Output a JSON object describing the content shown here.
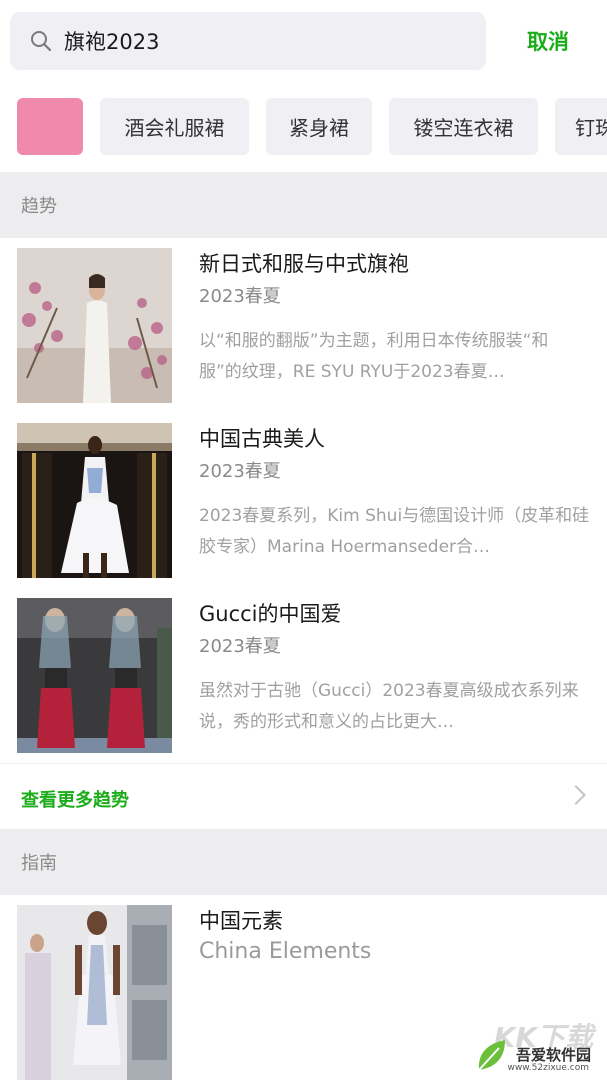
{
  "search": {
    "query": "旗袍2023",
    "cancel_label": "取消"
  },
  "colors": {
    "accent_green": "#1aad19",
    "chip_pink": "#f08aac",
    "chip_bg": "#efeff4",
    "section_bg": "#ededf0"
  },
  "chips": [
    {
      "label": "",
      "color": "#f08aac"
    },
    {
      "label": "酒会礼服裙"
    },
    {
      "label": "紧身裙"
    },
    {
      "label": "镂空连衣裙"
    },
    {
      "label": "钉珠"
    }
  ],
  "trends": {
    "section_title": "趋势",
    "items": [
      {
        "title": "新日式和服与中式旗袍",
        "season": "2023春夏",
        "description": "以“和服的翻版”为主题，利用日本传统服装“和服”的纹理，RE SYU RYU于2023春夏…"
      },
      {
        "title": "中国古典美人",
        "season": "2023春夏",
        "description": "2023春夏系列，Kim Shui与德国设计师（皮革和硅胶专家）Marina Hoermanseder合…"
      },
      {
        "title": "Gucci的中国爱",
        "season": "2023春夏",
        "description": "虽然对于古驰（Gucci）2023春夏高级成衣系列来说，秀的形式和意义的占比更大…"
      }
    ],
    "more_label": "查看更多趋势"
  },
  "guides": {
    "section_title": "指南",
    "items": [
      {
        "title": "中国元素",
        "subtitle": "China Elements"
      }
    ]
  },
  "watermark": {
    "brand": "吾爱软件园",
    "url": "www.52zixue.com",
    "logo_text": "KK下载"
  }
}
